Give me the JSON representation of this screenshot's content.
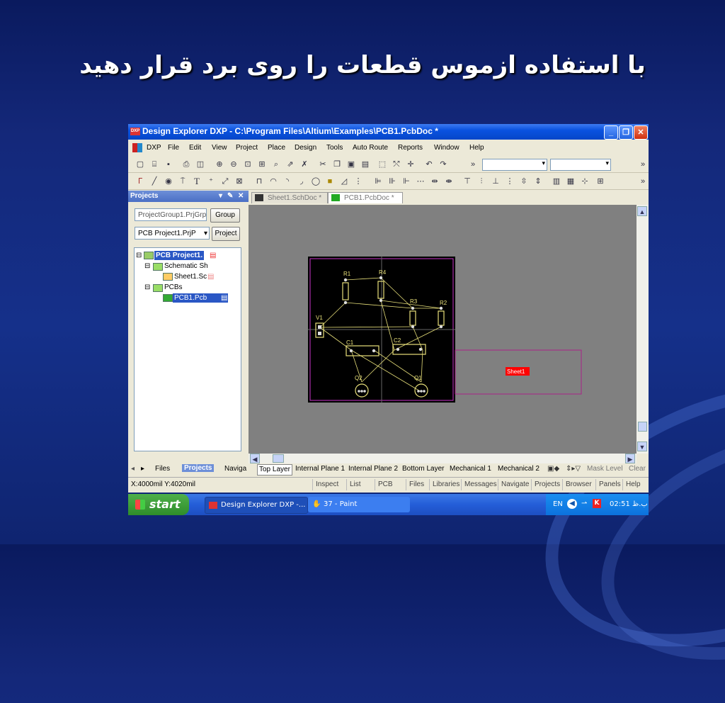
{
  "slide": {
    "title": "با استفاده ازموس قطعات را روی برد قرار دهید"
  },
  "window": {
    "title": "Design Explorer DXP - C:\\Program Files\\Altium\\Examples\\PCB1.PcbDoc *",
    "app_icon": "DXP",
    "min_icon": "minimize-icon",
    "max_icon": "restore-icon",
    "close_icon": "close-icon"
  },
  "menu": [
    "DXP",
    "File",
    "Edit",
    "View",
    "Project",
    "Place",
    "Design",
    "Tools",
    "Auto Route",
    "Reports",
    "Window",
    "Help"
  ],
  "panel": {
    "title": "Projects",
    "group_field": "ProjectGroup1.PrjGrp",
    "group_button": "Group",
    "project_select": "PCB Project1.PrjP",
    "project_button": "Project",
    "tree": {
      "project": "PCB Project1.",
      "schematic_folder": "Schematic Sh",
      "sheet": "Sheet1.Sc",
      "pcbs_folder": "PCBs",
      "pcb": "PCB1.Pcb"
    },
    "bottom_tabs": [
      "Files",
      "Projects",
      "Naviga"
    ]
  },
  "doc_tabs": [
    "Sheet1.SchDoc *",
    "PCB1.PcbDoc *"
  ],
  "board": {
    "components": [
      "R1",
      "R4",
      "R3",
      "R2",
      "V1",
      "C1",
      "C2",
      "Q2",
      "Q1"
    ],
    "sheet_label": "Sheet1",
    "colors": {
      "board_bg": "#000000",
      "outline": "#cc33cc",
      "component": "#e8e07a",
      "track": "#e8e07a",
      "sheet_label_bg": "#ff0000",
      "canvas": "#808080"
    }
  },
  "layers": [
    "Top Layer",
    "Internal Plane 1",
    "Internal Plane 2",
    "Bottom Layer",
    "Mechanical 1",
    "Mechanical 2"
  ],
  "layer_controls": [
    "Mask Level",
    "Clear"
  ],
  "status": {
    "coords": "X:4000mil Y:4020mil",
    "buttons": [
      "Inspect",
      "List",
      "PCB",
      "Files",
      "Libraries",
      "Messages",
      "Navigate",
      "Projects",
      "Browser",
      "Panels",
      "Help"
    ]
  },
  "taskbar": {
    "start": "start",
    "tasks": [
      "Design Explorer DXP -...",
      "37 - Paint"
    ],
    "lang": "EN",
    "clock": "02:51 ب.ظ"
  }
}
